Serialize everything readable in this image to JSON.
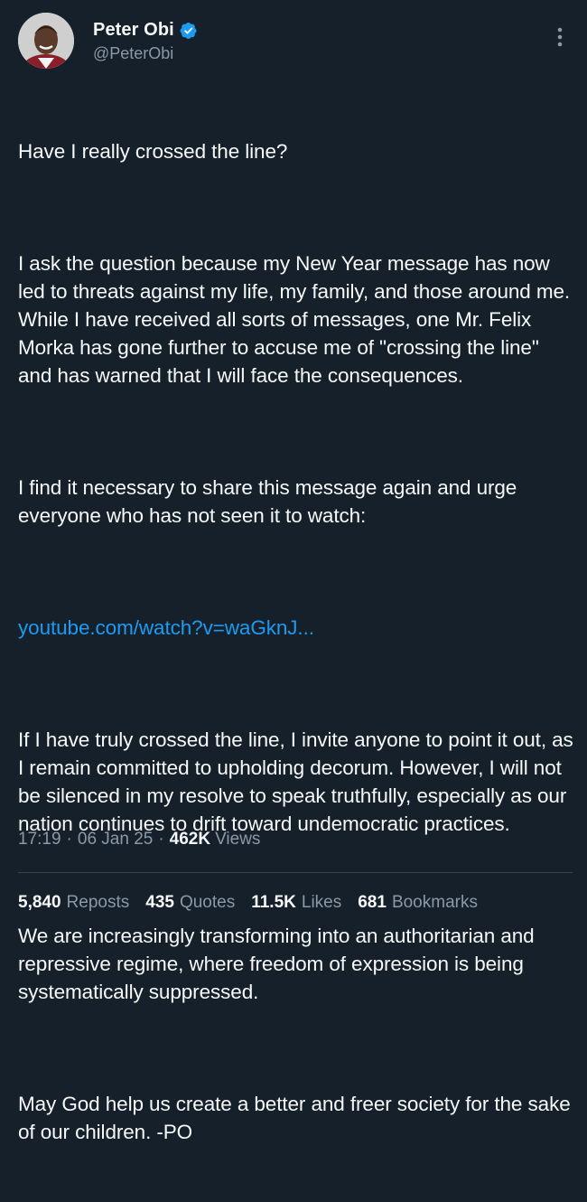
{
  "author": {
    "display_name": "Peter Obi",
    "handle": "@PeterObi",
    "verified": true,
    "verified_badge_color": "#1d9bf0"
  },
  "icons": {
    "verified": "verified-badge-icon",
    "more": "more-vertical-icon"
  },
  "tweet": {
    "p1": "Have I really crossed the line?",
    "p2": "I ask the question because my New Year message has now led to threats against my life, my family, and those around me. While I have received all sorts of messages, one Mr. Felix Morka has gone further to accuse me of \"crossing the line\" and has warned that I will face the consequences.",
    "p3": "I find it necessary to share this message again and urge everyone who has not seen it to watch:",
    "link": "youtube.com/watch?v=waGknJ...",
    "p4": "If I have truly crossed the line, I invite anyone to point it out, as I remain committed to upholding decorum. However, I will not be silenced in my resolve to speak truthfully, especially as our nation continues to drift toward undemocratic practices.",
    "p5": "We are increasingly transforming into an authoritarian and repressive regime, where freedom of expression is being systematically suppressed.",
    "p6": "May God help us create a better and freer society for the sake of our children. -PO"
  },
  "meta": {
    "time": "17:19",
    "date": "06 Jan 25",
    "separator": "·",
    "views_count": "462K",
    "views_label": "Views"
  },
  "stats": {
    "reposts_count": "5,840",
    "reposts_label": "Reposts",
    "quotes_count": "435",
    "quotes_label": "Quotes",
    "likes_count": "11.5K",
    "likes_label": "Likes",
    "bookmarks_count": "681",
    "bookmarks_label": "Bookmarks"
  },
  "colors": {
    "background": "#15202b",
    "text": "#f7f9f9",
    "secondary": "#8b98a5",
    "link": "#1d9bf0",
    "divider": "#38444d"
  }
}
